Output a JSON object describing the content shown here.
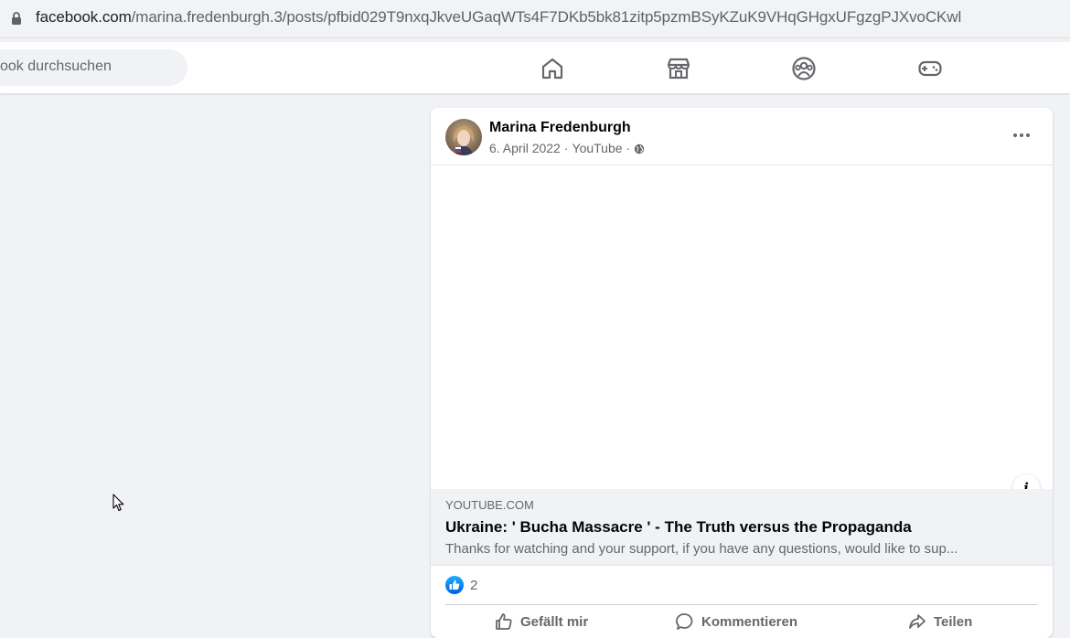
{
  "browser": {
    "url_host": "facebook.com",
    "url_path": "/marina.fredenburgh.3/posts/pfbid029T9nxqJkveUGaqWTs4F7DKb5bk81zitp5pzmBSyKZuK9VHqGHgxUFgzgPJXvoCKwl",
    "lock_icon": "lock-icon"
  },
  "topnav": {
    "search_placeholder": "ook durchsuchen",
    "icons": [
      "home-icon",
      "marketplace-icon",
      "groups-icon",
      "gaming-icon"
    ]
  },
  "post": {
    "author": "Marina Fredenburgh",
    "date": "6. April 2022",
    "source": "YouTube",
    "separator": "·",
    "privacy_icon": "globe-icon",
    "more_icon": "more-options-icon",
    "info_icon_label": "i",
    "link": {
      "domain": "YOUTUBE.COM",
      "title": "Ukraine: ' Bucha Massacre ' - The Truth versus the Propaganda",
      "description": "Thanks for watching and your support, if you have any questions, would like to sup..."
    },
    "reactions": {
      "icon": "like-icon",
      "count": "2"
    },
    "actions": [
      {
        "icon": "like-outline-icon",
        "label": "Gefällt mir"
      },
      {
        "icon": "comment-icon",
        "label": "Kommentieren"
      },
      {
        "icon": "share-icon",
        "label": "Teilen"
      }
    ]
  },
  "colors": {
    "brand_blue": "#1877f2",
    "page_bg": "#f0f2f5",
    "secondary_text": "#65676b"
  }
}
